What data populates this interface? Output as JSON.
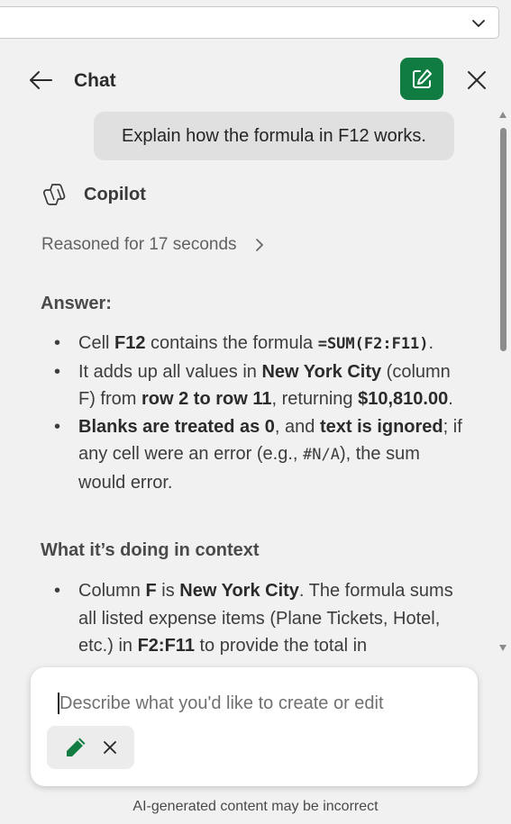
{
  "header": {
    "title": "Chat"
  },
  "conversation": {
    "user_message": "Explain how the formula in F12 works.",
    "assistant_name": "Copilot",
    "reasoned_label": "Reasoned for 17 seconds",
    "answer_heading": "Answer:",
    "answer_bullets": [
      {
        "parts": [
          {
            "t": "Cell ",
            "s": "n"
          },
          {
            "t": "F12",
            "s": "b"
          },
          {
            "t": " contains the formula ",
            "s": "n"
          },
          {
            "t": "=SUM(F2:F11)",
            "s": "code"
          },
          {
            "t": ".",
            "s": "n"
          }
        ]
      },
      {
        "parts": [
          {
            "t": "It adds up all values in ",
            "s": "n"
          },
          {
            "t": "New York City",
            "s": "b"
          },
          {
            "t": " (column F) from ",
            "s": "n"
          },
          {
            "t": "row 2 to row 11",
            "s": "b"
          },
          {
            "t": ", returning ",
            "s": "n"
          },
          {
            "t": "$10,810.00",
            "s": "b"
          },
          {
            "t": ".",
            "s": "n"
          }
        ]
      },
      {
        "parts": [
          {
            "t": "Blanks are treated as 0",
            "s": "b"
          },
          {
            "t": ", and ",
            "s": "n"
          },
          {
            "t": "text is ignored",
            "s": "b"
          },
          {
            "t": "; if any cell were an error (e.g., ",
            "s": "n"
          },
          {
            "t": "#N/A",
            "s": "codeplain"
          },
          {
            "t": "), the sum would error.",
            "s": "n"
          }
        ]
      }
    ],
    "context_heading": "What it’s doing in context",
    "context_bullets": [
      {
        "parts": [
          {
            "t": "Column ",
            "s": "n"
          },
          {
            "t": "F",
            "s": "b"
          },
          {
            "t": " is ",
            "s": "n"
          },
          {
            "t": "New York City",
            "s": "b"
          },
          {
            "t": ". The formula sums all listed expense items (Plane Tickets, Hotel, etc.) in ",
            "s": "n"
          },
          {
            "t": "F2:F11",
            "s": "b"
          },
          {
            "t": " to provide the total in",
            "s": "n"
          }
        ]
      }
    ]
  },
  "composer": {
    "placeholder": "Describe what you'd like to create or edit"
  },
  "footer": {
    "disclaimer": "AI-generated content may be incorrect"
  },
  "colors": {
    "accent": "#107c41",
    "background": "#f1f1f1"
  },
  "icons": {
    "back": "arrow-left-icon",
    "new_chat": "compose-icon",
    "close": "close-icon",
    "copilot": "copilot-logo-icon",
    "reasoned_expand": "chevron-right-icon",
    "edit_mode": "pencil-icon",
    "remove_mode": "close-icon",
    "top_dropdown": "chevron-down-icon"
  }
}
